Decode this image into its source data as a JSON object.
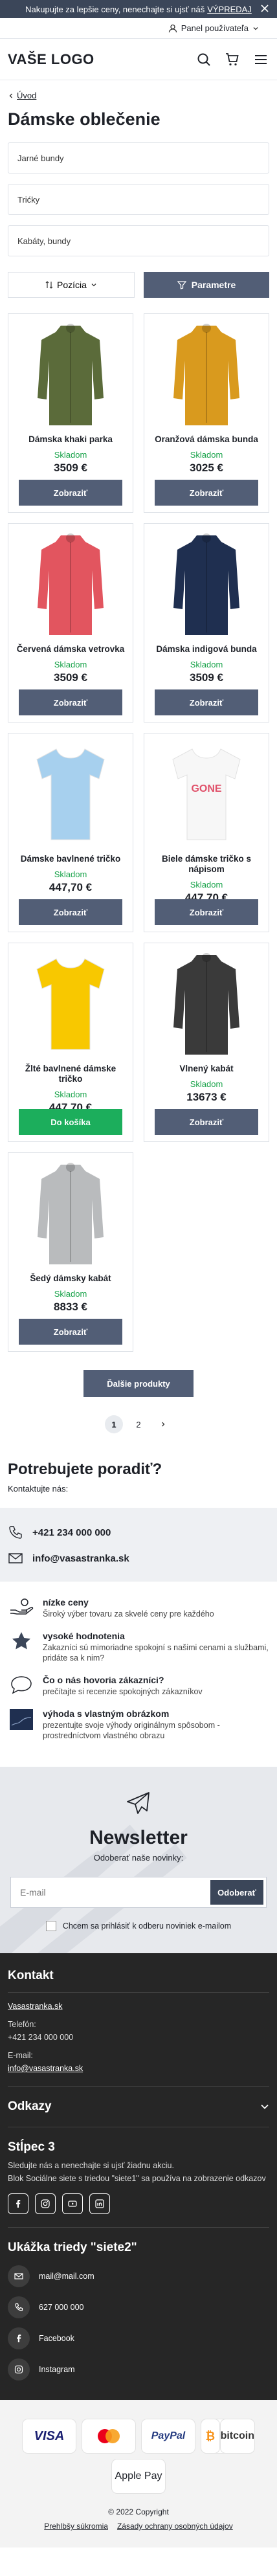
{
  "topbar": {
    "text": "Nakupujte za lepšie ceny, nenechajte si ujsť náš",
    "link": "VÝPREDAJ"
  },
  "userbar": {
    "label": "Panel používateľa"
  },
  "header": {
    "logo": "VAŠE LOGO"
  },
  "breadcrumb": {
    "back": "Úvod"
  },
  "page": {
    "title": "Dámske oblečenie"
  },
  "filters": [
    "Jarné bundy",
    "Trićky",
    "Kabáty, bundy"
  ],
  "controls": {
    "sort": "Pozícia",
    "params": "Parametre"
  },
  "products": [
    {
      "name": "Dámska khaki parka",
      "stock": "Skladom",
      "price": "3509 €",
      "button": "Zobraziť",
      "color": "#5b6b3a"
    },
    {
      "name": "Oranžová dámska bunda",
      "stock": "Skladom",
      "price": "3025 €",
      "button": "Zobraziť",
      "color": "#d99a1e"
    },
    {
      "name": "Červená dámska vetrovka",
      "stock": "Skladom",
      "price": "3509 €",
      "button": "Zobraziť",
      "color": "#e2555f"
    },
    {
      "name": "Dámska indigová bunda",
      "stock": "Skladom",
      "price": "3509 €",
      "button": "Zobraziť",
      "color": "#1f2f50"
    },
    {
      "name": "Dámske bavlnené tričko",
      "stock": "Skladom",
      "price": "447,70 €",
      "button": "Zobraziť",
      "color": "#a7d0ee"
    },
    {
      "name": "Biele dámske tričko s nápisom",
      "stock": "Skladom",
      "price": "447,70 €",
      "button": "Zobraziť",
      "color": "#f7f7f7",
      "print": "GONE"
    },
    {
      "name": "Žlté bavlnené dámske tričko",
      "stock": "Skladom",
      "price": "447,70 €",
      "button": "Do košíka",
      "color": "#f8c800"
    },
    {
      "name": "Vlnený kabát",
      "stock": "Skladom",
      "price": "13673 €",
      "button": "Zobraziť",
      "color": "#3a3a3a"
    },
    {
      "name": "Šedý dámsky kabát",
      "stock": "Skladom",
      "price": "8833 €",
      "button": "Zobraziť",
      "color": "#b9bbbd"
    }
  ],
  "more": {
    "label": "Ďalšie produkty"
  },
  "pager": {
    "pages": [
      "1",
      "2"
    ]
  },
  "help": {
    "title": "Potrebujete poradiť?",
    "sub": "Kontaktujte nás:",
    "phone": "+421 234 000 000",
    "email": "info@vasastranka.sk"
  },
  "usp": [
    {
      "title": "nízke ceny",
      "desc": "Široký výber tovaru za skvelé ceny pre každého"
    },
    {
      "title": "vysoké hodnotenia",
      "desc": "Zakazníci sú mimoriadne spokojní s našimi cenami a službami, pridáte sa k nim?"
    },
    {
      "title": "Čo o nás hovoria zákazníci?",
      "desc": "prečítajte si recenzie spokojných zákazníkov"
    },
    {
      "title": "výhoda s vlastným obrázkom",
      "desc": "prezentujte svoje výhody originálnym spôsobom - prostredníctvom vlastného obrazu"
    }
  ],
  "newsletter": {
    "title": "Newsletter",
    "sub": "Odoberať naše novinky:",
    "placeholder": "E-mail",
    "button": "Odoberať",
    "consent": "Chcem sa prihlásiť k odberu noviniek e-mailom"
  },
  "footer": {
    "contact_title": "Kontakt",
    "site": "Vasastranka.sk",
    "phone_label": "Telefón:",
    "phone": "+421 234 000 000",
    "email_label": "E-mail:",
    "email": "info@vasastranka.sk",
    "links_title": "Odkazy",
    "col3_title": "Stĺpec 3",
    "col3_text1": "Sledujte nás a nenechajte si ujsť žiadnu akciu.",
    "col3_text2": "Blok Sociálne siete s triedou \"siete1\" sa používa na zobrazenie odkazov",
    "col4_title": "Ukážka triedy \"siete2\"",
    "list": [
      "mail@mail.com",
      "627 000 000",
      "Facebook",
      "Instagram"
    ]
  },
  "payments": [
    "VISA",
    "Mastercard",
    "PayPal",
    "bitcoin",
    "Apple Pay"
  ],
  "bottom": {
    "copyright": "© 2022 Copyright",
    "privacy": "Prehlbšy súkromia",
    "policy": "Zásady ochrany osobných údajov"
  }
}
